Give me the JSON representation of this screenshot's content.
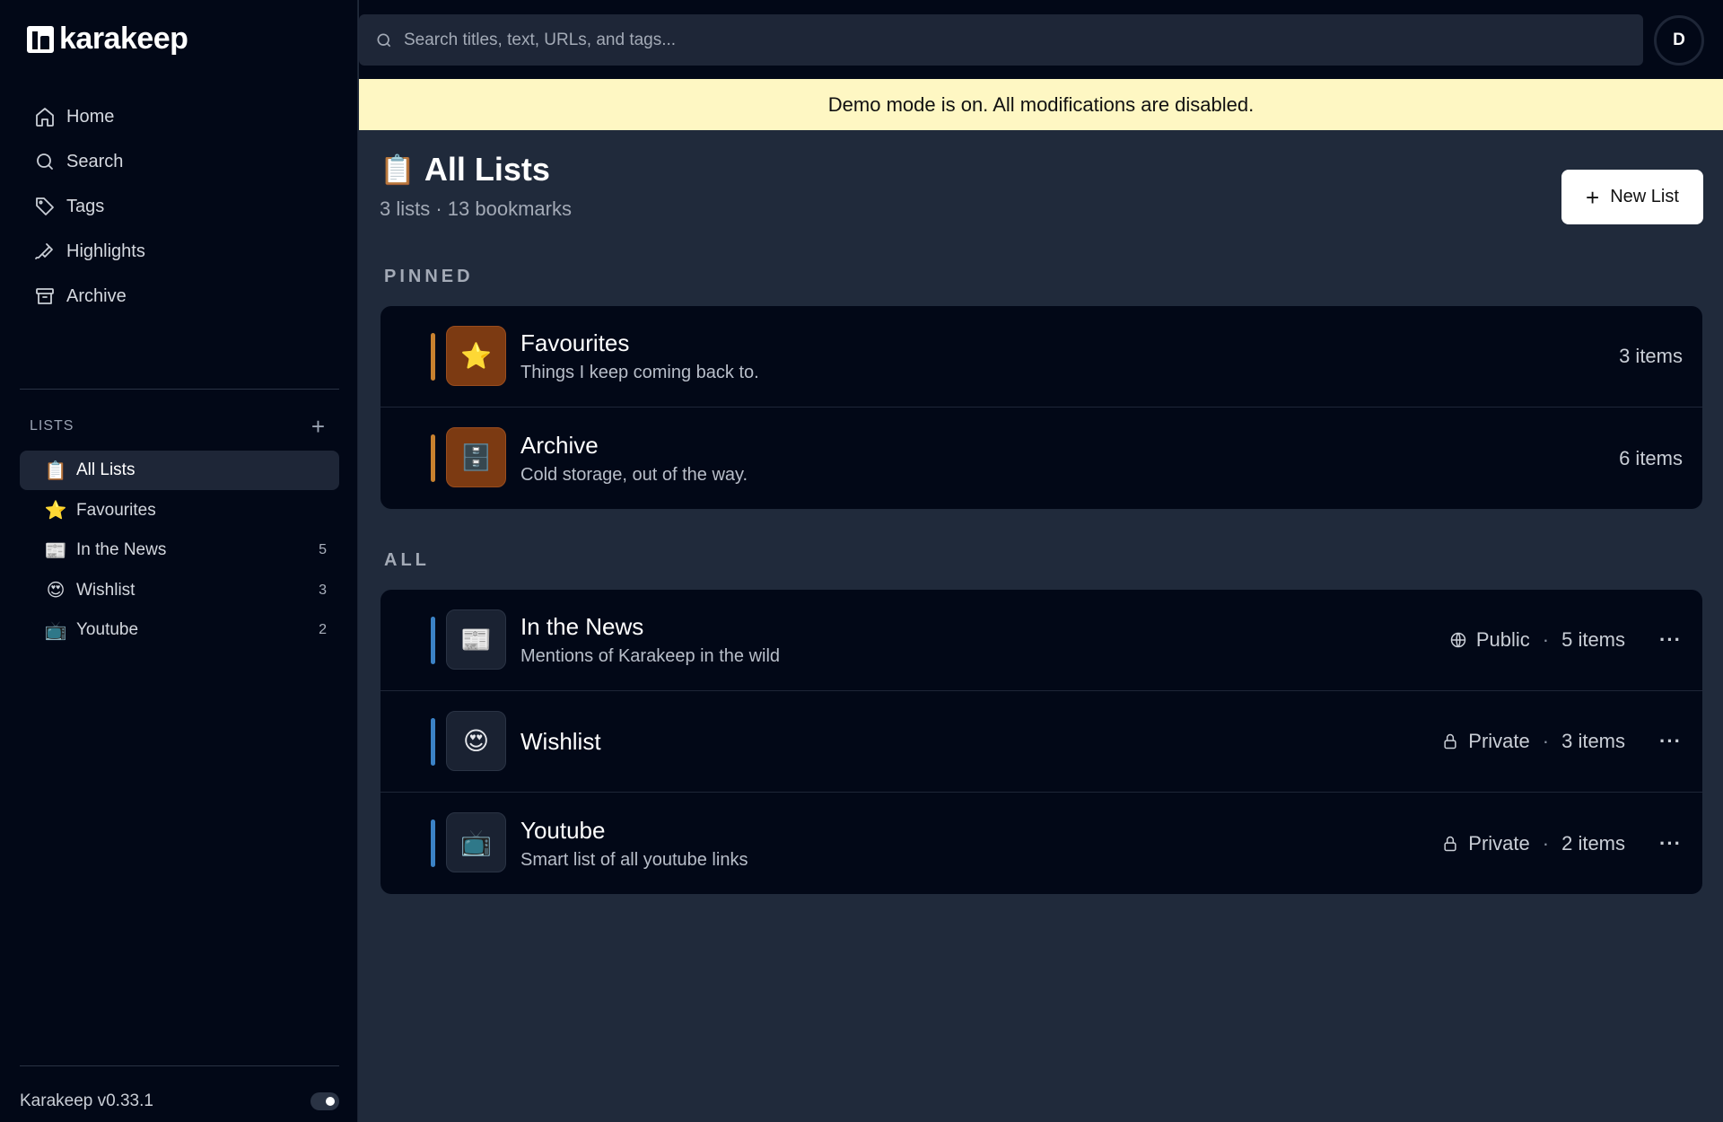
{
  "app": {
    "name": "karakeep",
    "version": "Karakeep v0.33.1"
  },
  "nav": [
    {
      "label": "Home",
      "icon": "home-icon"
    },
    {
      "label": "Search",
      "icon": "search-icon"
    },
    {
      "label": "Tags",
      "icon": "tag-icon"
    },
    {
      "label": "Highlights",
      "icon": "highlighter-icon"
    },
    {
      "label": "Archive",
      "icon": "archive-icon"
    }
  ],
  "lists_header": "LISTS",
  "side_lists": [
    {
      "emoji": "📋",
      "label": "All Lists",
      "count": ""
    },
    {
      "emoji": "⭐",
      "label": "Favourites",
      "count": ""
    },
    {
      "emoji": "📰",
      "label": "In the News",
      "count": "5"
    },
    {
      "emoji": "😍",
      "label": "Wishlist",
      "count": "3"
    },
    {
      "emoji": "📺",
      "label": "Youtube",
      "count": "2"
    }
  ],
  "search": {
    "placeholder": "Search titles, text, URLs, and tags..."
  },
  "avatar": {
    "initial": "D"
  },
  "banner": "Demo mode is on. All modifications are disabled.",
  "page": {
    "emoji": "📋",
    "title": "All Lists",
    "subtitle": "3 lists · 13 bookmarks",
    "new_list_label": "New List"
  },
  "sections": {
    "pinned": {
      "label": "PINNED",
      "items": [
        {
          "emoji": "⭐",
          "name": "Favourites",
          "desc": "Things I keep coming back to.",
          "count": "3 items"
        },
        {
          "emoji": "🗄️",
          "name": "Archive",
          "desc": "Cold storage, out of the way.",
          "count": "6 items"
        }
      ]
    },
    "all": {
      "label": "ALL",
      "items": [
        {
          "emoji": "📰",
          "name": "In the News",
          "desc": "Mentions of Karakeep in the wild",
          "visibility": "Public",
          "count": "5 items"
        },
        {
          "emoji": "😍",
          "name": "Wishlist",
          "desc": "",
          "visibility": "Private",
          "count": "3 items"
        },
        {
          "emoji": "📺",
          "name": "Youtube",
          "desc": "Smart list of all youtube links",
          "visibility": "Private",
          "count": "2 items"
        }
      ]
    }
  },
  "more_label": "···",
  "colors": {
    "accent_orange": "#c8812f",
    "accent_blue": "#3b82c6",
    "banner": "#fef7c3"
  }
}
